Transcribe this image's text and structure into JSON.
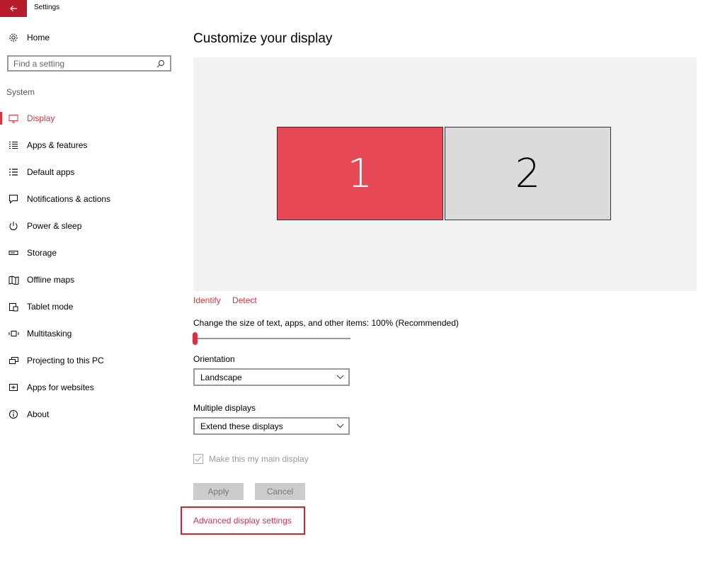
{
  "window": {
    "title": "Settings"
  },
  "sidebar": {
    "home_label": "Home",
    "search_placeholder": "Find a setting",
    "section": "System",
    "items": [
      {
        "label": "Display",
        "icon": "monitor-icon",
        "active": true
      },
      {
        "label": "Apps & features",
        "icon": "apps-list-icon"
      },
      {
        "label": "Default apps",
        "icon": "default-apps-icon"
      },
      {
        "label": "Notifications & actions",
        "icon": "notification-icon"
      },
      {
        "label": "Power & sleep",
        "icon": "power-icon"
      },
      {
        "label": "Storage",
        "icon": "storage-icon"
      },
      {
        "label": "Offline maps",
        "icon": "map-icon"
      },
      {
        "label": "Tablet mode",
        "icon": "tablet-icon"
      },
      {
        "label": "Multitasking",
        "icon": "multitasking-icon"
      },
      {
        "label": "Projecting to this PC",
        "icon": "projecting-icon"
      },
      {
        "label": "Apps for websites",
        "icon": "apps-websites-icon"
      },
      {
        "label": "About",
        "icon": "info-icon"
      }
    ]
  },
  "main": {
    "title": "Customize your display",
    "monitors": [
      "1",
      "2"
    ],
    "identify": "Identify",
    "detect": "Detect",
    "scale_label": "Change the size of text, apps, and other items: 100% (Recommended)",
    "scale_fraction": 0.0,
    "orientation_label": "Orientation",
    "orientation_value": "Landscape",
    "multiple_label": "Multiple displays",
    "multiple_value": "Extend these displays",
    "main_display_label": "Make this my main display",
    "apply": "Apply",
    "cancel": "Cancel",
    "advanced": "Advanced display settings"
  },
  "colors": {
    "accent": "#e0303f",
    "titlebar_back": "#b91d2b",
    "monitor_selected": "#e74856",
    "highlight_box": "#d9202e"
  }
}
